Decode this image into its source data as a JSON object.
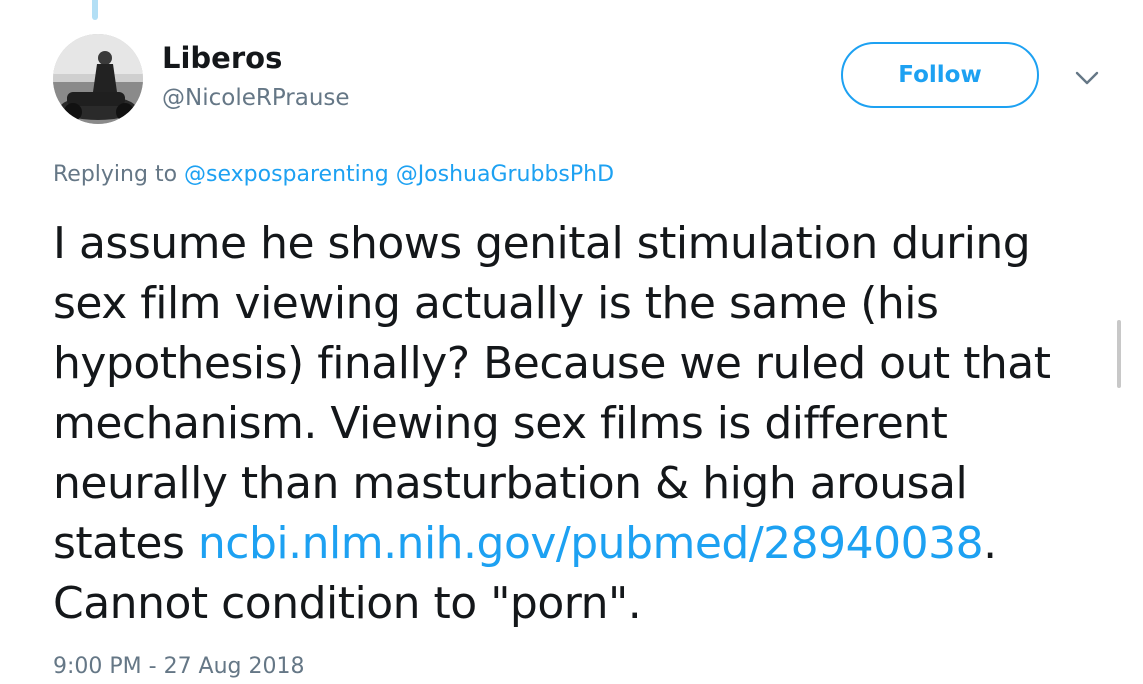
{
  "tweet": {
    "author": {
      "display_name": "Liberos",
      "handle": "@NicoleRPrause"
    },
    "follow_label": "Follow",
    "replying": {
      "prefix": "Replying to",
      "mentions": [
        "@sexposparenting",
        "@JoshuaGrubbsPhD"
      ]
    },
    "text_lines": [
      "I assume he shows genital stimulation during",
      "sex film viewing actually is the same (his",
      "hypothesis) finally? Because we ruled out that",
      "mechanism. Viewing sex films is different",
      "neurally than masturbation & high arousal"
    ],
    "last_line_prefix": "states ",
    "link": "ncbi.nlm.nih.gov/pubmed/28940038",
    "last_line_suffix": ".",
    "final_line": "Cannot condition to \"porn\".",
    "timestamp": "9:00 PM - 27 Aug 2018"
  },
  "icons": {
    "caret": "chevron-down-icon"
  },
  "colors": {
    "accent": "#1da1f2",
    "muted_text": "#657786",
    "primary_text": "#14171a",
    "thread_line": "#b3dff5"
  }
}
